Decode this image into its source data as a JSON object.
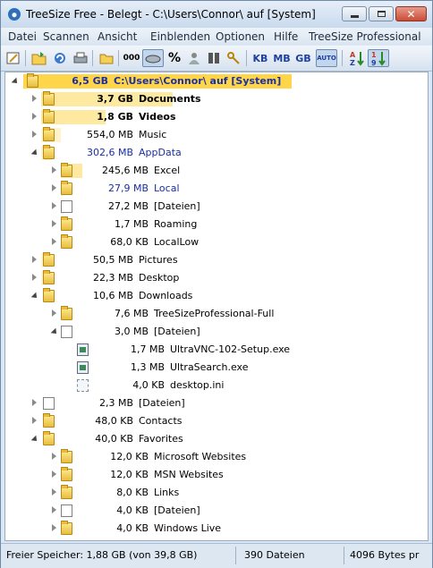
{
  "window": {
    "title": "TreeSize Free - Belegt - C:\\Users\\Connor\\ auf [System]"
  },
  "menu": [
    "Datei",
    "Scannen",
    "Ansicht",
    "Einblenden",
    "Optionen",
    "Hilfe",
    "TreeSize Professional"
  ],
  "toolbar": {
    "icons": [
      "open-folder-icon",
      "refresh-icon",
      "print-icon",
      "folder-icon",
      "digits-icon",
      "disk-icon",
      "percent-icon",
      "users-icon",
      "columns-icon",
      "key-icon",
      "kb-icon",
      "mb-icon",
      "gb-icon",
      "auto-icon",
      "sort-az-icon",
      "sort-size-icon"
    ],
    "pct_label": "%",
    "digits_label": "000",
    "kb_label": "KB",
    "mb_label": "MB",
    "gb_label": "GB",
    "auto_label": "AUTO"
  },
  "tree": [
    {
      "size": "6,5 GB",
      "name": "C:\\Users\\Connor\\ auf [System]",
      "level": 0,
      "icon": "folder",
      "expand": "open",
      "bold": true,
      "blue": true,
      "fill": 1.0
    },
    {
      "size": "3,7 GB",
      "name": "Documents",
      "level": 1,
      "icon": "folder",
      "expand": "closed",
      "bold": true,
      "fill": 0.57
    },
    {
      "size": "1,8 GB",
      "name": "Videos",
      "level": 1,
      "icon": "folder",
      "expand": "closed",
      "bold": true,
      "fill": 0.28
    },
    {
      "size": "554,0 MB",
      "name": "Music",
      "level": 1,
      "icon": "folder",
      "expand": "closed",
      "fill": 0.085
    },
    {
      "size": "302,6 MB",
      "name": "AppData",
      "level": 1,
      "icon": "folder",
      "expand": "open",
      "blue": true,
      "fill": 0.047
    },
    {
      "size": "245,6 MB",
      "name": "Excel",
      "level": 2,
      "icon": "folder",
      "expand": "closed",
      "fill": 0.81
    },
    {
      "size": "27,9 MB",
      "name": "Local",
      "level": 2,
      "icon": "folder",
      "expand": "closed",
      "blue": true,
      "fill": 0.09
    },
    {
      "size": "27,2 MB",
      "name": "[Dateien]",
      "level": 2,
      "icon": "file",
      "expand": "closed",
      "fill": 0.09
    },
    {
      "size": "1,7 MB",
      "name": "Roaming",
      "level": 2,
      "icon": "folder",
      "expand": "closed",
      "fill": 0.006
    },
    {
      "size": "68,0 KB",
      "name": "LocalLow",
      "level": 2,
      "icon": "folder",
      "expand": "closed",
      "fill": 0.0
    },
    {
      "size": "50,5 MB",
      "name": "Pictures",
      "level": 1,
      "icon": "folder",
      "expand": "closed",
      "fill": 0.008
    },
    {
      "size": "22,3 MB",
      "name": "Desktop",
      "level": 1,
      "icon": "folder",
      "expand": "closed",
      "fill": 0.003
    },
    {
      "size": "10,6 MB",
      "name": "Downloads",
      "level": 1,
      "icon": "folder",
      "expand": "open",
      "fill": 0.0
    },
    {
      "size": "7,6 MB",
      "name": "TreeSizeProfessional-Full",
      "level": 2,
      "icon": "folder",
      "expand": "closed",
      "fill": 0.0
    },
    {
      "size": "3,0 MB",
      "name": "[Dateien]",
      "level": 2,
      "icon": "file",
      "expand": "open",
      "fill": 0.0
    },
    {
      "size": "1,7 MB",
      "name": "UltraVNC-102-Setup.exe",
      "level": 3,
      "icon": "exe",
      "expand": "none",
      "fill": 0.0
    },
    {
      "size": "1,3 MB",
      "name": "UltraSearch.exe",
      "level": 3,
      "icon": "exe",
      "expand": "none",
      "fill": 0.0
    },
    {
      "size": "4,0 KB",
      "name": "desktop.ini",
      "level": 3,
      "icon": "ini",
      "expand": "none",
      "fill": 0.0
    },
    {
      "size": "2,3 MB",
      "name": "[Dateien]",
      "level": 1,
      "icon": "file",
      "expand": "closed",
      "fill": 0.0
    },
    {
      "size": "48,0 KB",
      "name": "Contacts",
      "level": 1,
      "icon": "folder",
      "expand": "closed",
      "fill": 0.0
    },
    {
      "size": "40,0 KB",
      "name": "Favorites",
      "level": 1,
      "icon": "folder",
      "expand": "open",
      "fill": 0.0
    },
    {
      "size": "12,0 KB",
      "name": "Microsoft Websites",
      "level": 2,
      "icon": "folder",
      "expand": "closed",
      "fill": 0.0
    },
    {
      "size": "12,0 KB",
      "name": "MSN Websites",
      "level": 2,
      "icon": "folder",
      "expand": "closed",
      "fill": 0.0
    },
    {
      "size": "8,0 KB",
      "name": "Links",
      "level": 2,
      "icon": "folder",
      "expand": "closed",
      "fill": 0.0
    },
    {
      "size": "4,0 KB",
      "name": "[Dateien]",
      "level": 2,
      "icon": "file",
      "expand": "closed",
      "fill": 0.0
    },
    {
      "size": "4,0 KB",
      "name": "Windows Live",
      "level": 2,
      "icon": "folder",
      "expand": "closed",
      "fill": 0.0
    }
  ],
  "status": {
    "free": "Freier Speicher: 1,88 GB  (von 39,8 GB)",
    "files": "390  Dateien",
    "cluster": "4096 Bytes pr"
  },
  "colors": {
    "bar_root": "#ffd54a",
    "bar_sub": "#fde9a0",
    "bar_faint": "#fff3cc"
  }
}
